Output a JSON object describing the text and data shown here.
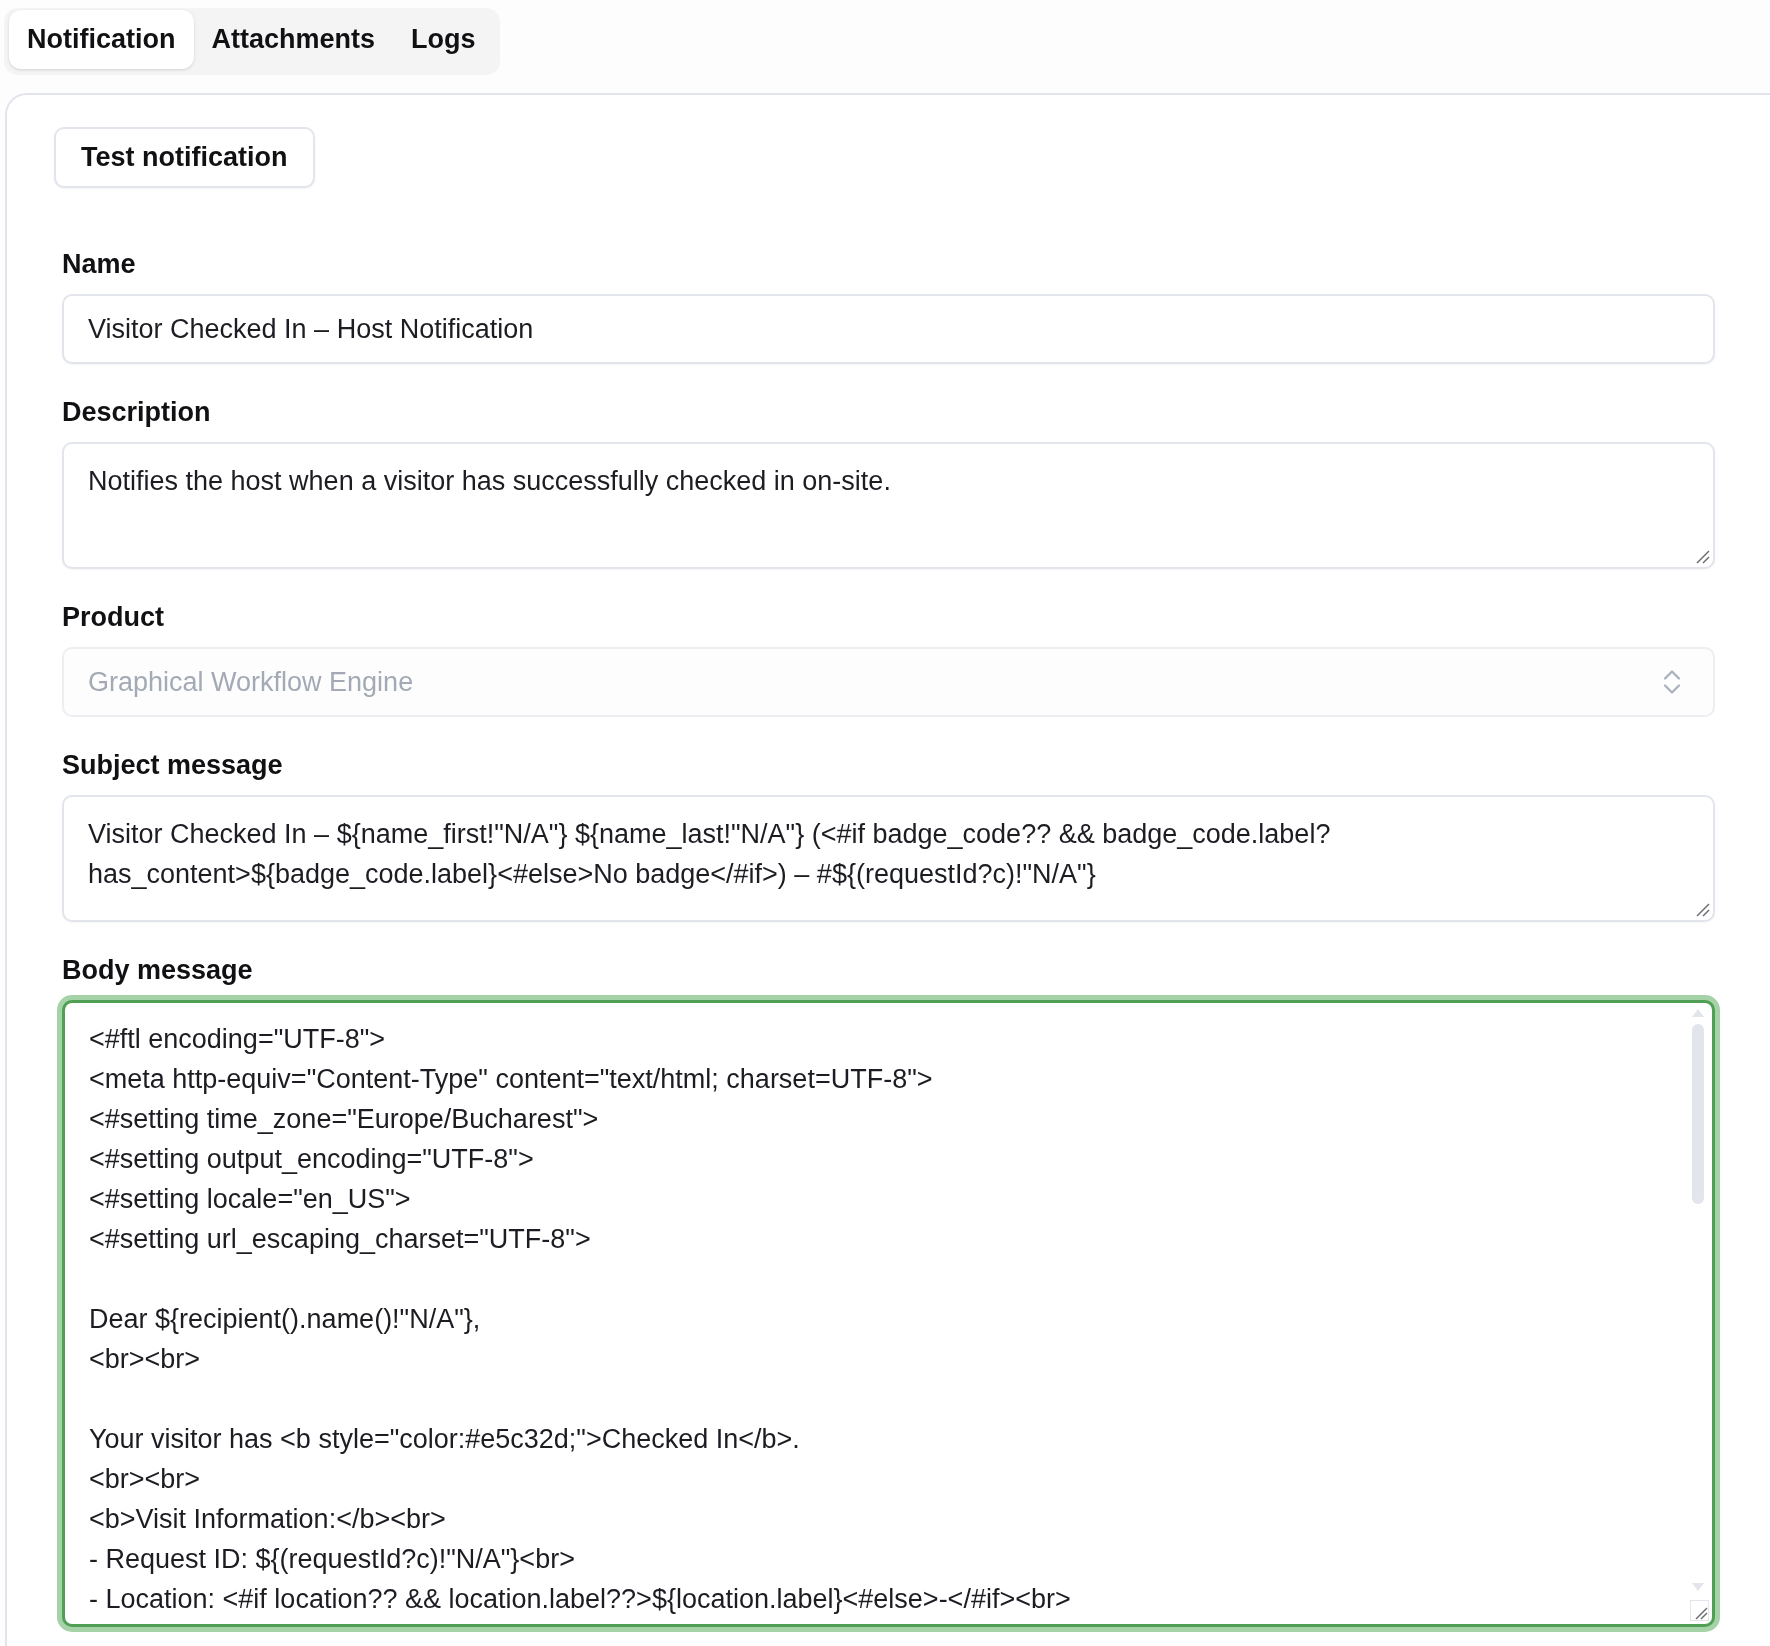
{
  "tabs": [
    {
      "label": "Notification",
      "selected": true
    },
    {
      "label": "Attachments",
      "selected": false
    },
    {
      "label": "Logs",
      "selected": false
    }
  ],
  "test_button": {
    "label": "Test notification"
  },
  "form": {
    "fields": [
      {
        "kind": "input",
        "label": "Name",
        "value": "Visitor Checked In – Host Notification"
      },
      {
        "kind": "textarea",
        "label": "Description",
        "value": "Notifies the host when a visitor has successfully checked in on-site."
      },
      {
        "kind": "select",
        "label": "Product",
        "value": "Graphical Workflow Engine",
        "disabled": true
      },
      {
        "kind": "textarea",
        "label": "Subject message",
        "value": "Visitor Checked In – ${name_first!\"N/A\"} ${name_last!\"N/A\"} (<#if badge_code?? && badge_code.label?has_content>${badge_code.label}<#else>No badge</#if>) – #${(requestId?c)!\"N/A\"}"
      },
      {
        "kind": "textarea",
        "label": "Body message",
        "focused": true,
        "scrollbar": true,
        "value": "<#ftl encoding=\"UTF-8\">\n<meta http-equiv=\"Content-Type\" content=\"text/html; charset=UTF-8\">\n<#setting time_zone=\"Europe/Bucharest\">\n<#setting output_encoding=\"UTF-8\">\n<#setting locale=\"en_US\">\n<#setting url_escaping_charset=\"UTF-8\">\n\nDear ${recipient().name()!\"N/A\"},\n<br><br>\n\nYour visitor has <b style=\"color:#e5c32d;\">Checked In</b>.\n<br><br>\n<b>Visit Information:</b><br>\n- Request ID: ${(requestId?c)!\"N/A\"}<br>\n- Location: <#if location?? && location.label??>${location.label}<#else>-</#if><br>"
      }
    ]
  }
}
